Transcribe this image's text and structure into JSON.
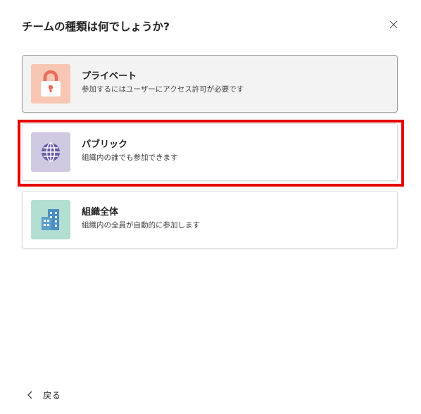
{
  "dialog": {
    "title": "チームの種類は何でしょうか?"
  },
  "options": [
    {
      "name": "プライベート",
      "description": "参加するにはユーザーにアクセス許可が必要です",
      "icon": "lock-icon",
      "tile_color": "#f8c7b4",
      "state": "selected"
    },
    {
      "name": "パブリック",
      "description": "組織内の誰でも参加できます",
      "icon": "globe-icon",
      "tile_color": "#cfc9e1",
      "state": "highlighted"
    },
    {
      "name": "組織全体",
      "description": "組織内の全員が自動的に参加します",
      "icon": "building-icon",
      "tile_color": "#b3ded2",
      "state": "default"
    }
  ],
  "footer": {
    "back_label": "戻る"
  },
  "colors": {
    "highlight": "#e60000",
    "lock": "#ea6b5b",
    "globe": "#6b5fa8",
    "building": "#4a8fc1"
  }
}
